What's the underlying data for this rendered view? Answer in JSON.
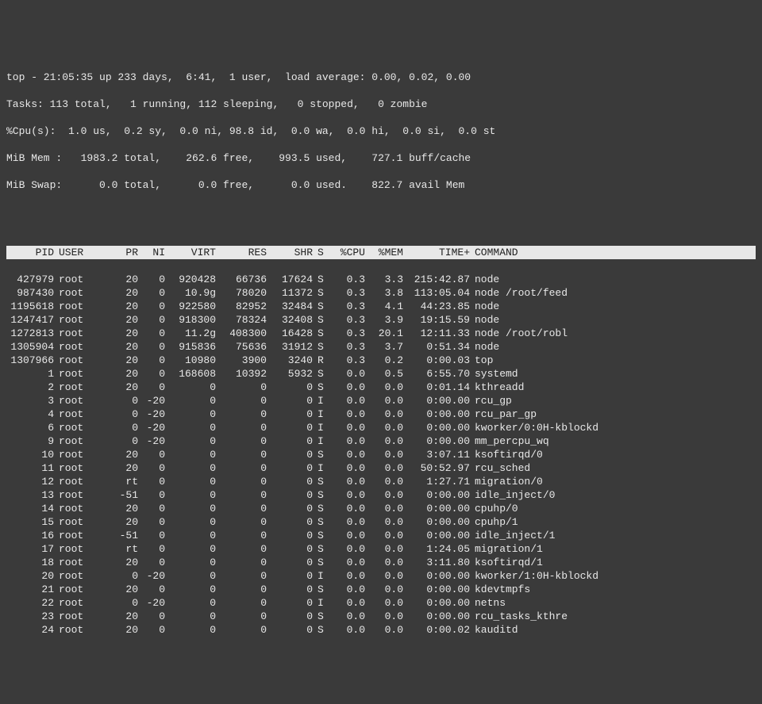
{
  "summary": {
    "line1": "top - 21:05:35 up 233 days,  6:41,  1 user,  load average: 0.00, 0.02, 0.00",
    "line2": "Tasks: 113 total,   1 running, 112 sleeping,   0 stopped,   0 zombie",
    "line3": "%Cpu(s):  1.0 us,  0.2 sy,  0.0 ni, 98.8 id,  0.0 wa,  0.0 hi,  0.0 si,  0.0 st",
    "line4": "MiB Mem :   1983.2 total,    262.6 free,    993.5 used,    727.1 buff/cache",
    "line5": "MiB Swap:      0.0 total,      0.0 free,      0.0 used.    822.7 avail Mem"
  },
  "columns": {
    "pid": "PID",
    "user": "USER",
    "pr": "PR",
    "ni": "NI",
    "virt": "VIRT",
    "res": "RES",
    "shr": "SHR",
    "s": "S",
    "cpu": "%CPU",
    "mem": "%MEM",
    "time": "TIME+",
    "cmd": "COMMAND"
  },
  "rows": [
    {
      "pid": "427979",
      "user": "root",
      "pr": "20",
      "ni": "0",
      "virt": "920428",
      "res": "66736",
      "shr": "17624",
      "s": "S",
      "cpu": "0.3",
      "mem": "3.3",
      "time": "215:42.87",
      "cmd": "node"
    },
    {
      "pid": "987430",
      "user": "root",
      "pr": "20",
      "ni": "0",
      "virt": "10.9g",
      "res": "78020",
      "shr": "11372",
      "s": "S",
      "cpu": "0.3",
      "mem": "3.8",
      "time": "113:05.04",
      "cmd": "node /root/feed"
    },
    {
      "pid": "1195618",
      "user": "root",
      "pr": "20",
      "ni": "0",
      "virt": "922580",
      "res": "82952",
      "shr": "32484",
      "s": "S",
      "cpu": "0.3",
      "mem": "4.1",
      "time": "44:23.85",
      "cmd": "node"
    },
    {
      "pid": "1247417",
      "user": "root",
      "pr": "20",
      "ni": "0",
      "virt": "918300",
      "res": "78324",
      "shr": "32408",
      "s": "S",
      "cpu": "0.3",
      "mem": "3.9",
      "time": "19:15.59",
      "cmd": "node"
    },
    {
      "pid": "1272813",
      "user": "root",
      "pr": "20",
      "ni": "0",
      "virt": "11.2g",
      "res": "408300",
      "shr": "16428",
      "s": "S",
      "cpu": "0.3",
      "mem": "20.1",
      "time": "12:11.33",
      "cmd": "node /root/robl"
    },
    {
      "pid": "1305904",
      "user": "root",
      "pr": "20",
      "ni": "0",
      "virt": "915836",
      "res": "75636",
      "shr": "31912",
      "s": "S",
      "cpu": "0.3",
      "mem": "3.7",
      "time": "0:51.34",
      "cmd": "node"
    },
    {
      "pid": "1307966",
      "user": "root",
      "pr": "20",
      "ni": "0",
      "virt": "10980",
      "res": "3900",
      "shr": "3240",
      "s": "R",
      "cpu": "0.3",
      "mem": "0.2",
      "time": "0:00.03",
      "cmd": "top"
    },
    {
      "pid": "1",
      "user": "root",
      "pr": "20",
      "ni": "0",
      "virt": "168608",
      "res": "10392",
      "shr": "5932",
      "s": "S",
      "cpu": "0.0",
      "mem": "0.5",
      "time": "6:55.70",
      "cmd": "systemd"
    },
    {
      "pid": "2",
      "user": "root",
      "pr": "20",
      "ni": "0",
      "virt": "0",
      "res": "0",
      "shr": "0",
      "s": "S",
      "cpu": "0.0",
      "mem": "0.0",
      "time": "0:01.14",
      "cmd": "kthreadd"
    },
    {
      "pid": "3",
      "user": "root",
      "pr": "0",
      "ni": "-20",
      "virt": "0",
      "res": "0",
      "shr": "0",
      "s": "I",
      "cpu": "0.0",
      "mem": "0.0",
      "time": "0:00.00",
      "cmd": "rcu_gp"
    },
    {
      "pid": "4",
      "user": "root",
      "pr": "0",
      "ni": "-20",
      "virt": "0",
      "res": "0",
      "shr": "0",
      "s": "I",
      "cpu": "0.0",
      "mem": "0.0",
      "time": "0:00.00",
      "cmd": "rcu_par_gp"
    },
    {
      "pid": "6",
      "user": "root",
      "pr": "0",
      "ni": "-20",
      "virt": "0",
      "res": "0",
      "shr": "0",
      "s": "I",
      "cpu": "0.0",
      "mem": "0.0",
      "time": "0:00.00",
      "cmd": "kworker/0:0H-kblockd"
    },
    {
      "pid": "9",
      "user": "root",
      "pr": "0",
      "ni": "-20",
      "virt": "0",
      "res": "0",
      "shr": "0",
      "s": "I",
      "cpu": "0.0",
      "mem": "0.0",
      "time": "0:00.00",
      "cmd": "mm_percpu_wq"
    },
    {
      "pid": "10",
      "user": "root",
      "pr": "20",
      "ni": "0",
      "virt": "0",
      "res": "0",
      "shr": "0",
      "s": "S",
      "cpu": "0.0",
      "mem": "0.0",
      "time": "3:07.11",
      "cmd": "ksoftirqd/0"
    },
    {
      "pid": "11",
      "user": "root",
      "pr": "20",
      "ni": "0",
      "virt": "0",
      "res": "0",
      "shr": "0",
      "s": "I",
      "cpu": "0.0",
      "mem": "0.0",
      "time": "50:52.97",
      "cmd": "rcu_sched"
    },
    {
      "pid": "12",
      "user": "root",
      "pr": "rt",
      "ni": "0",
      "virt": "0",
      "res": "0",
      "shr": "0",
      "s": "S",
      "cpu": "0.0",
      "mem": "0.0",
      "time": "1:27.71",
      "cmd": "migration/0"
    },
    {
      "pid": "13",
      "user": "root",
      "pr": "-51",
      "ni": "0",
      "virt": "0",
      "res": "0",
      "shr": "0",
      "s": "S",
      "cpu": "0.0",
      "mem": "0.0",
      "time": "0:00.00",
      "cmd": "idle_inject/0"
    },
    {
      "pid": "14",
      "user": "root",
      "pr": "20",
      "ni": "0",
      "virt": "0",
      "res": "0",
      "shr": "0",
      "s": "S",
      "cpu": "0.0",
      "mem": "0.0",
      "time": "0:00.00",
      "cmd": "cpuhp/0"
    },
    {
      "pid": "15",
      "user": "root",
      "pr": "20",
      "ni": "0",
      "virt": "0",
      "res": "0",
      "shr": "0",
      "s": "S",
      "cpu": "0.0",
      "mem": "0.0",
      "time": "0:00.00",
      "cmd": "cpuhp/1"
    },
    {
      "pid": "16",
      "user": "root",
      "pr": "-51",
      "ni": "0",
      "virt": "0",
      "res": "0",
      "shr": "0",
      "s": "S",
      "cpu": "0.0",
      "mem": "0.0",
      "time": "0:00.00",
      "cmd": "idle_inject/1"
    },
    {
      "pid": "17",
      "user": "root",
      "pr": "rt",
      "ni": "0",
      "virt": "0",
      "res": "0",
      "shr": "0",
      "s": "S",
      "cpu": "0.0",
      "mem": "0.0",
      "time": "1:24.05",
      "cmd": "migration/1"
    },
    {
      "pid": "18",
      "user": "root",
      "pr": "20",
      "ni": "0",
      "virt": "0",
      "res": "0",
      "shr": "0",
      "s": "S",
      "cpu": "0.0",
      "mem": "0.0",
      "time": "3:11.80",
      "cmd": "ksoftirqd/1"
    },
    {
      "pid": "20",
      "user": "root",
      "pr": "0",
      "ni": "-20",
      "virt": "0",
      "res": "0",
      "shr": "0",
      "s": "I",
      "cpu": "0.0",
      "mem": "0.0",
      "time": "0:00.00",
      "cmd": "kworker/1:0H-kblockd"
    },
    {
      "pid": "21",
      "user": "root",
      "pr": "20",
      "ni": "0",
      "virt": "0",
      "res": "0",
      "shr": "0",
      "s": "S",
      "cpu": "0.0",
      "mem": "0.0",
      "time": "0:00.00",
      "cmd": "kdevtmpfs"
    },
    {
      "pid": "22",
      "user": "root",
      "pr": "0",
      "ni": "-20",
      "virt": "0",
      "res": "0",
      "shr": "0",
      "s": "I",
      "cpu": "0.0",
      "mem": "0.0",
      "time": "0:00.00",
      "cmd": "netns"
    },
    {
      "pid": "23",
      "user": "root",
      "pr": "20",
      "ni": "0",
      "virt": "0",
      "res": "0",
      "shr": "0",
      "s": "S",
      "cpu": "0.0",
      "mem": "0.0",
      "time": "0:00.00",
      "cmd": "rcu_tasks_kthre"
    },
    {
      "pid": "24",
      "user": "root",
      "pr": "20",
      "ni": "0",
      "virt": "0",
      "res": "0",
      "shr": "0",
      "s": "S",
      "cpu": "0.0",
      "mem": "0.0",
      "time": "0:00.02",
      "cmd": "kauditd"
    }
  ]
}
